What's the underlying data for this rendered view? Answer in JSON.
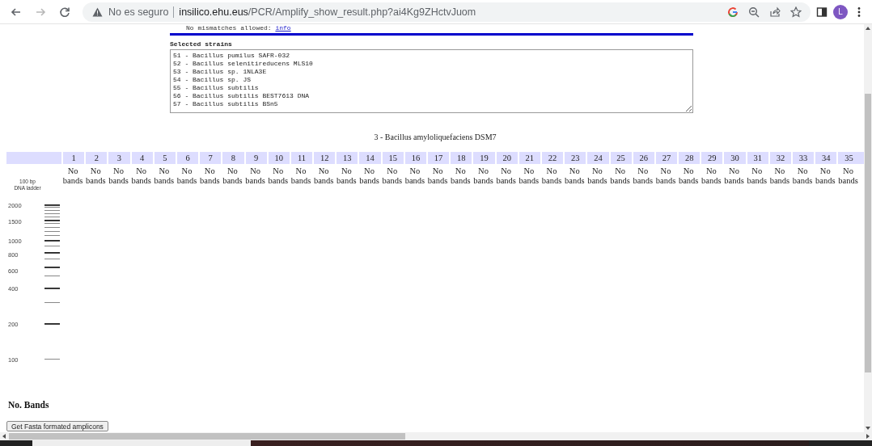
{
  "browser": {
    "nav": [
      {
        "kind": "back",
        "disabled": false
      },
      {
        "kind": "forward",
        "disabled": true
      },
      {
        "kind": "reload",
        "disabled": false
      }
    ],
    "security": "No es seguro",
    "url_host": "insilico.ehu.eus",
    "url_path": "/PCR/Amplify_show_result.php?ai4Kg9ZHctvJuom",
    "profile_initial": "L"
  },
  "options_note": {
    "text": "No mismatches allowed:",
    "link": "info"
  },
  "selected_strains": {
    "label": "Selected strains",
    "items": [
      "51 - Bacillus pumilus SAFR-032",
      "52 - Bacillus selenitireducens MLS10",
      "53 - Bacillus sp. 1NLA3E",
      "54 - Bacillus sp. JS",
      "55 - Bacillus subtilis",
      "56 - Bacillus subtilis BEST7613 DNA",
      "57 - Bacillus subtilis BSn5"
    ]
  },
  "result": {
    "title": "3 - Bacillus amyloliquefaciens DSM7",
    "ladder": {
      "title": "100 bp\nDNA ladder",
      "labels": [
        "2000",
        "1500",
        "1000",
        "800",
        "600",
        "400",
        "200",
        "100"
      ]
    },
    "lanes": [
      {
        "number": "1",
        "result": "No bands"
      },
      {
        "number": "2",
        "result": "No bands"
      },
      {
        "number": "3",
        "result": "No bands"
      },
      {
        "number": "4",
        "result": "No bands"
      },
      {
        "number": "5",
        "result": "No bands"
      },
      {
        "number": "6",
        "result": "No bands"
      },
      {
        "number": "7",
        "result": "No bands"
      },
      {
        "number": "8",
        "result": "No bands"
      },
      {
        "number": "9",
        "result": "No bands"
      },
      {
        "number": "10",
        "result": "No bands"
      },
      {
        "number": "11",
        "result": "No bands"
      },
      {
        "number": "12",
        "result": "No bands"
      },
      {
        "number": "13",
        "result": "No bands"
      },
      {
        "number": "14",
        "result": "No bands"
      },
      {
        "number": "15",
        "result": "No bands"
      },
      {
        "number": "16",
        "result": "No bands"
      },
      {
        "number": "17",
        "result": "No bands"
      },
      {
        "number": "18",
        "result": "No bands"
      },
      {
        "number": "19",
        "result": "No bands"
      },
      {
        "number": "20",
        "result": "No bands"
      },
      {
        "number": "21",
        "result": "No bands"
      },
      {
        "number": "22",
        "result": "No bands"
      },
      {
        "number": "23",
        "result": "No bands"
      },
      {
        "number": "24",
        "result": "No bands"
      },
      {
        "number": "25",
        "result": "No bands"
      },
      {
        "number": "26",
        "result": "No bands"
      },
      {
        "number": "27",
        "result": "No bands"
      },
      {
        "number": "28",
        "result": "No bands"
      },
      {
        "number": "29",
        "result": "No bands"
      },
      {
        "number": "30",
        "result": "No bands"
      },
      {
        "number": "31",
        "result": "No bands"
      },
      {
        "number": "32",
        "result": "No bands"
      },
      {
        "number": "33",
        "result": "No bands"
      },
      {
        "number": "34",
        "result": "No bands"
      },
      {
        "number": "35",
        "result": "No bands"
      }
    ]
  },
  "bands_heading": "No. Bands",
  "fasta_button": "Get Fasta formated amplicons"
}
